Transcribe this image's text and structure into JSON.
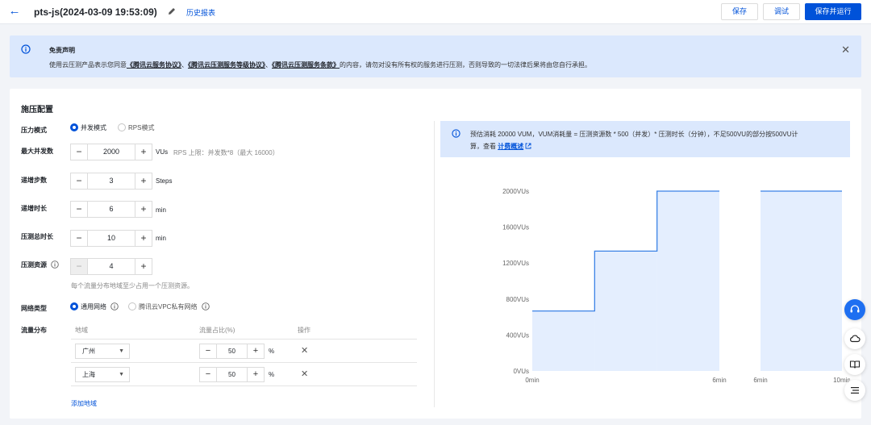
{
  "header": {
    "title": "pts-js(2024-03-09 19:53:09)",
    "history_link": "历史报表",
    "buttons": {
      "save": "保存",
      "debug": "调试",
      "save_run": "保存并运行"
    }
  },
  "notice": {
    "title": "免责声明",
    "text_before": "使用云压测产品表示您同意",
    "link1": "《腾讯云服务协议》",
    "sep1": "、",
    "link2": "《腾讯云压测服务等级协议》",
    "sep2": "、",
    "link3": "《腾讯云压测服务条款》",
    "text_after": "的内容，请勿对没有所有权的服务进行压测，否则导致的一切法律后果将由您自行承担。"
  },
  "config": {
    "title": "施压配置",
    "pressure_mode": {
      "label": "压力模式",
      "options": [
        "并发模式",
        "RPS模式"
      ],
      "selected": "并发模式"
    },
    "max_concurrency": {
      "label": "最大并发数",
      "value": "2000",
      "unit": "VUs",
      "hint": "RPS 上限：并发数*8（最大 16000）"
    },
    "ramp_steps": {
      "label": "递增步数",
      "value": "3",
      "unit": "Steps"
    },
    "ramp_duration": {
      "label": "递增时长",
      "value": "6",
      "unit": "min"
    },
    "total_duration": {
      "label": "压测总时长",
      "value": "10",
      "unit": "min"
    },
    "resources": {
      "label": "压测资源",
      "value": "4",
      "hint": "每个流量分布地域至少占用一个压测资源。"
    },
    "network": {
      "label": "网络类型",
      "options": [
        "通用网络",
        "腾讯云VPC私有网络"
      ],
      "selected": "通用网络"
    },
    "traffic": {
      "label": "流量分布",
      "headers": [
        "地域",
        "流量占比(%)",
        "操作"
      ],
      "rows": [
        {
          "region": "广州",
          "percent": "50",
          "unit": "%"
        },
        {
          "region": "上海",
          "percent": "50",
          "unit": "%"
        }
      ],
      "add_label": "添加地域"
    }
  },
  "estimate": {
    "line1": "预估消耗 20000 VUM，VUM消耗量 = 压测资源数 * 500（并发）* 压测时长（分钟），不足500VU的部分按500VU计",
    "line2_prefix": "算，查看",
    "line2_link": "计费概述"
  },
  "chart_data": {
    "type": "line",
    "title": "",
    "xlabel": "",
    "ylabel": "",
    "y_ticks": [
      "0VUs",
      "400VUs",
      "800VUs",
      "1200VUs",
      "1600VUs",
      "2000VUs"
    ],
    "ylim": [
      0,
      2000
    ],
    "segments": [
      {
        "x_ticks": [
          "0min",
          "6min"
        ],
        "xlim": [
          0,
          6
        ],
        "steps": [
          {
            "x_start": 0,
            "x_end": 2,
            "y": 667
          },
          {
            "x_start": 2,
            "x_end": 4,
            "y": 1333
          },
          {
            "x_start": 4,
            "x_end": 6,
            "y": 2000
          }
        ]
      },
      {
        "x_ticks": [
          "6min",
          "10min"
        ],
        "xlim": [
          6,
          10
        ],
        "steps": [
          {
            "x_start": 6,
            "x_end": 10,
            "y": 2000
          }
        ]
      }
    ],
    "line_color": "#3b82e6",
    "fill_color": "#dbe8fd"
  },
  "icons": {
    "back": "back-arrow-icon",
    "edit": "pencil-icon",
    "info": "info-icon",
    "close": "close-icon",
    "delete": "x-icon",
    "external": "external-link-icon"
  },
  "colors": {
    "accent": "#0052d9",
    "notice_bg": "#dbe8fd"
  }
}
